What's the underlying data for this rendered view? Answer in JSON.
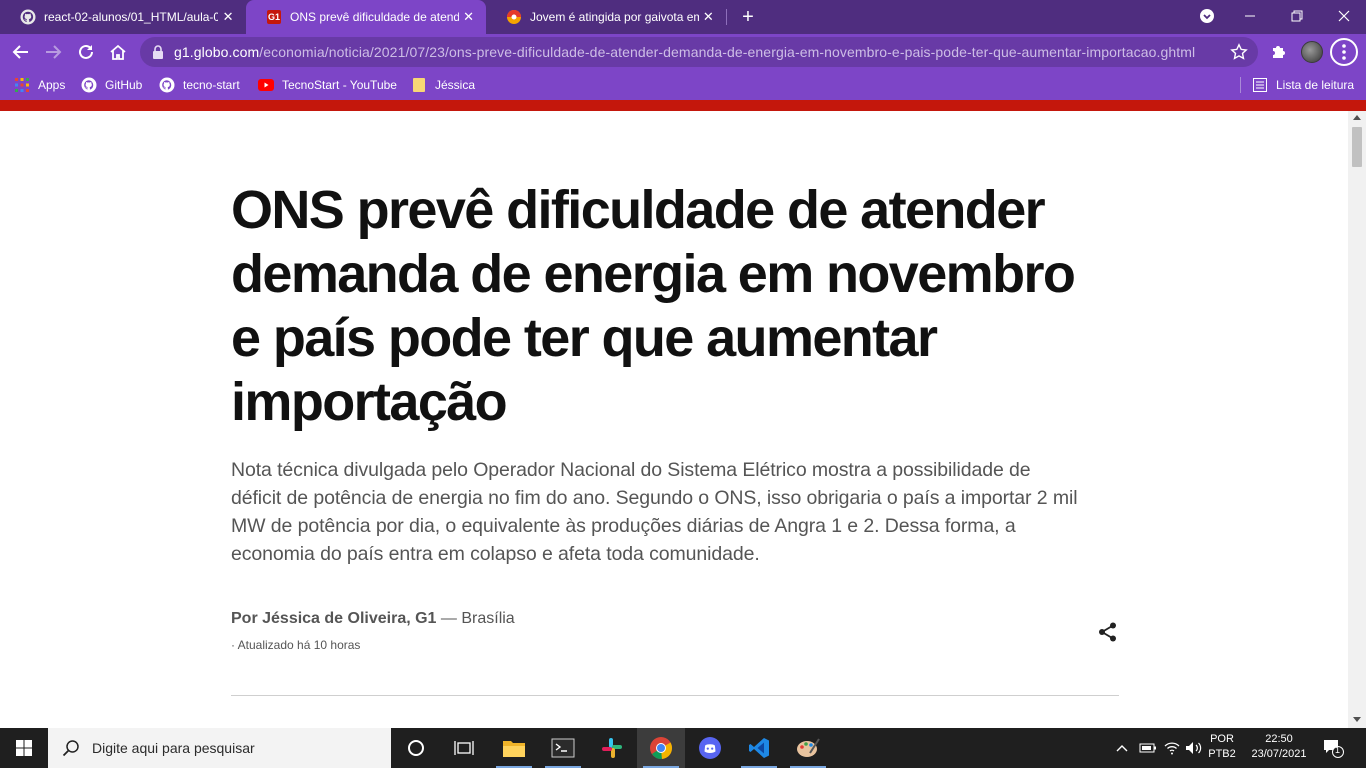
{
  "browser": {
    "tabs": [
      {
        "title": "react-02-alunos/01_HTML/aula-0",
        "icon": "github-icon"
      },
      {
        "title": "ONS prevê dificuldade de atender",
        "icon": "g1-icon",
        "favicon_text": "G1",
        "active": true
      },
      {
        "title": "Jovem é atingida por gaivota em",
        "icon": "ball-icon"
      }
    ],
    "url_host": "g1.globo.com",
    "url_path": "/economia/noticia/2021/07/23/ons-preve-dificuldade-de-atender-demanda-de-energia-em-novembro-e-pais-pode-ter-que-aumentar-importacao.ghtml",
    "bookmarks": [
      {
        "label": "Apps",
        "icon": "apps-grid-icon"
      },
      {
        "label": "GitHub",
        "icon": "github-icon"
      },
      {
        "label": "tecno-start",
        "icon": "github-icon"
      },
      {
        "label": "TecnoStart - YouTube",
        "icon": "youtube-icon"
      },
      {
        "label": "Jéssica",
        "icon": "folder-icon"
      }
    ],
    "reading_list": "Lista de leitura",
    "theme_colors": {
      "tabstrip": "#4f2d7f",
      "toolbar": "#7d45c7",
      "omnibox": "#683aa6"
    }
  },
  "article": {
    "brand_color": "#c4170c",
    "headline": "ONS prevê dificuldade de atender demanda de energia em novembro e país pode ter que aumentar importação",
    "subtitle": "Nota técnica divulgada pelo Operador Nacional do Sistema Elétrico mostra a possibilidade de déficit de potência de energia no fim do ano. Segundo o ONS, isso obrigaria o país a importar 2 mil MW de potência por dia, o equivalente às produções diárias de Angra 1 e 2. Dessa forma, a economia do país entra em colapso e afeta toda comunidade.",
    "byline_author": "Por Jéssica de Oliveira, G1",
    "byline_location": " — Brasília",
    "updated": "· Atualizado há 10 horas"
  },
  "taskbar": {
    "search_placeholder": "Digite aqui para pesquisar",
    "apps": [
      "task-view-icon",
      "taskview-grid-icon",
      "file-explorer-icon",
      "terminal-icon",
      "slack-icon",
      "chrome-icon",
      "discord-icon",
      "vscode-icon",
      "paint-icon"
    ],
    "language_top": "POR",
    "language_bottom": "PTB2",
    "time": "22:50",
    "date": "23/07/2021",
    "notification_count": "1"
  }
}
